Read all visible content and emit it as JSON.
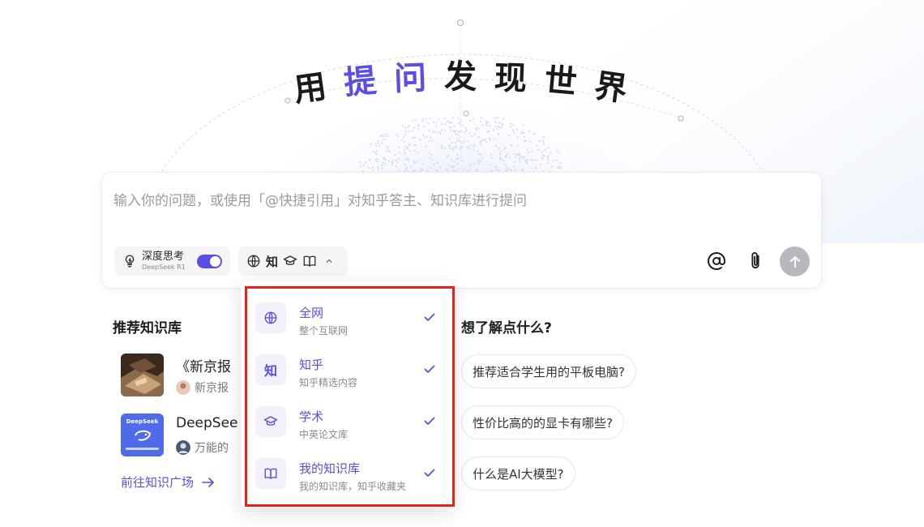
{
  "hero": {
    "c1": "用",
    "c2": "提",
    "c3": "问",
    "c4": "发",
    "c5": "现",
    "c6": "世",
    "c7": "界"
  },
  "input": {
    "placeholder": "输入你的问题，或使用「@快捷引用」对知乎答主、知识库进行提问",
    "deep_think_label": "深度思考",
    "deep_think_model": "DeepSeek R1",
    "deep_think_enabled": true,
    "source_short": "知"
  },
  "dropdown": {
    "items": [
      {
        "label": "全网",
        "desc": "整个互联网",
        "icon": "globe-icon",
        "checked": true
      },
      {
        "label": "知乎",
        "desc": "知乎精选内容",
        "icon_text": "知",
        "checked": true
      },
      {
        "label": "学术",
        "desc": "中英论文库",
        "icon": "graduation-cap-icon",
        "checked": true
      },
      {
        "label": "我的知识库",
        "desc": "我的知识库，知乎收藏夹",
        "icon": "book-icon",
        "checked": true
      }
    ]
  },
  "knowledge": {
    "title": "推荐知识库",
    "items": [
      {
        "title": "《新京报",
        "owner": "新京报",
        "thumb_text": ""
      },
      {
        "title": "DeepSee",
        "owner": "万能的",
        "thumb_text": "DeepSeek"
      }
    ],
    "link": "前往知识广场"
  },
  "questions": {
    "title": "想了解点什么?",
    "items": [
      "推荐适合学生用的平板电脑?",
      "性价比高的的显卡有哪些?",
      "什么是AI大模型?"
    ]
  },
  "colors": {
    "accent": "#5b4ee6",
    "highlight_frame": "#e2241a"
  }
}
